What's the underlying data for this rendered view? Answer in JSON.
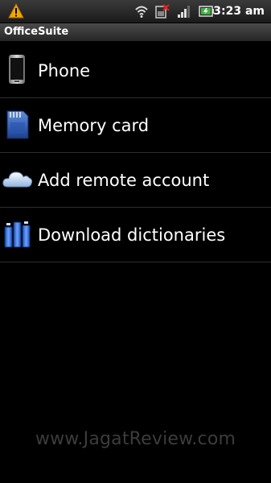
{
  "status_bar": {
    "time": "3:23 am",
    "icons": [
      "warning-icon",
      "wifi-icon",
      "no-sim-icon",
      "signal-icon",
      "battery-icon"
    ]
  },
  "app": {
    "title": "OfficeSuite"
  },
  "list": {
    "items": [
      {
        "label": "Phone",
        "icon": "phone-icon"
      },
      {
        "label": "Memory card",
        "icon": "memory-card-icon"
      },
      {
        "label": "Add remote account",
        "icon": "cloud-icon"
      },
      {
        "label": "Download dictionaries",
        "icon": "dictionaries-icon"
      }
    ]
  },
  "watermark": "www.JagatReview.com",
  "colors": {
    "background": "#000000",
    "text": "#ffffff",
    "divider": "#2e2e2e",
    "warning": "#f0a800",
    "icon_blue": "#3d7fd6"
  }
}
